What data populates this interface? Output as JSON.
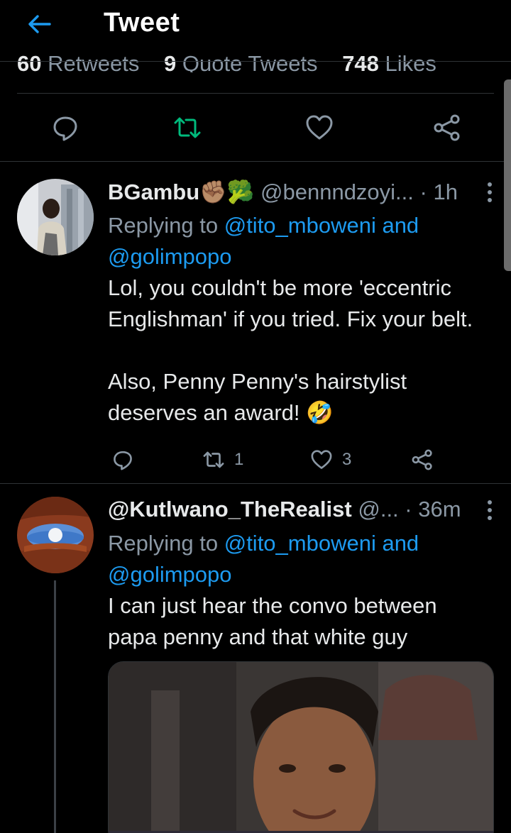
{
  "header": {
    "title": "Tweet",
    "back_icon": "arrow-left-icon",
    "accent": "#1d9bf0"
  },
  "stats": {
    "retweets_count": "60",
    "retweets_label": "Retweets",
    "quotes_count": "9",
    "quotes_label": "Quote Tweets",
    "likes_count": "748",
    "likes_label": "Likes"
  },
  "main_actions": {
    "icons": [
      "reply-icon",
      "retweet-icon",
      "like-icon",
      "share-icon"
    ],
    "retweet_color": "#00ba7c"
  },
  "replies": [
    {
      "display_name": "BGambu",
      "emoji": "✊🏽🥦",
      "handle": "@bennndzoyi...",
      "time": "· 1h",
      "replying_prefix": "Replying to",
      "replying_mentions": "@tito_mboweni and",
      "replying_mentions2": "@golimpopo",
      "text_line1": "Lol, you couldn't be more 'eccentric",
      "text_line2": "Englishman' if you tried. Fix your belt.",
      "text_line3": "Also, Penny Penny's hairstylist",
      "text_line4": "deserves an award!",
      "text_emoji": "🤣",
      "retweets": "1",
      "likes": "3"
    },
    {
      "display_name": "@Kutlwano_TheRealist",
      "handle": "@...",
      "time": "· 36m",
      "replying_prefix": "Replying to",
      "replying_mentions": "@tito_mboweni and",
      "replying_mentions2": "@golimpopo",
      "text_line1": "I can just hear the convo between",
      "text_line2": "papa penny and that white guy"
    }
  ]
}
